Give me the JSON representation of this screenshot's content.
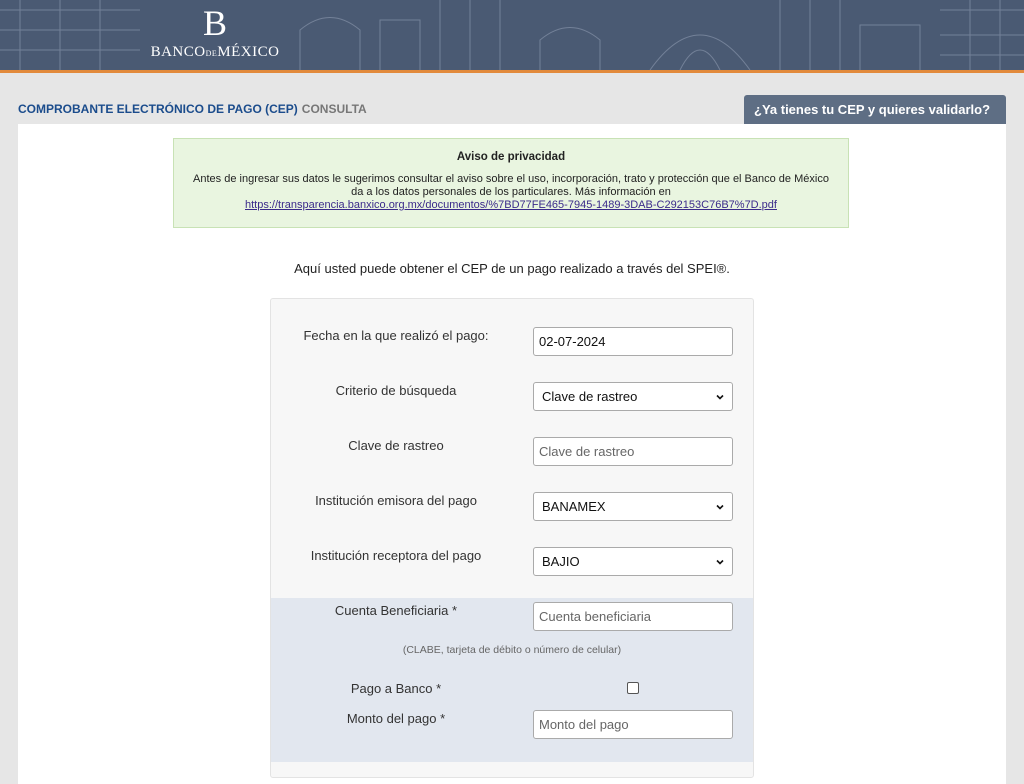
{
  "header": {
    "logo_mark": "B",
    "logo_name_left": "BANCO",
    "logo_name_mid": "DE",
    "logo_name_right": "MÉXICO"
  },
  "titlebar": {
    "title": "COMPROBANTE ELECTRÓNICO DE PAGO (CEP)",
    "subtitle": "CONSULTA",
    "validate_label": "¿Ya tienes tu CEP y quieres validarlo?"
  },
  "privacy": {
    "title": "Aviso de privacidad",
    "text_line1": "Antes de ingresar sus datos le sugerimos consultar el aviso sobre el uso, incorporación, trato y protección que el Banco de México",
    "text_line2": "da a los datos personales de los particulares. Más información en",
    "link": "https://transparencia.banxico.org.mx/documentos/%7BD77FE465-7945-1489-3DAB-C292153C76B7%7D.pdf"
  },
  "intro": "Aquí usted puede obtener el CEP de un pago realizado a través del SPEI®.",
  "form": {
    "fecha_label": "Fecha en la que realizó el pago:",
    "fecha_value": "02-07-2024",
    "criterio_label": "Criterio de búsqueda",
    "criterio_value": "Clave de rastreo",
    "clave_label": "Clave de rastreo",
    "clave_placeholder": "Clave de rastreo",
    "emisora_label": "Institución emisora del pago",
    "emisora_value": "BANAMEX",
    "receptora_label": "Institución receptora del pago",
    "receptora_value": "BAJIO",
    "cuenta_label": "Cuenta Beneficiaria *",
    "cuenta_placeholder": "Cuenta beneficiaria",
    "cuenta_hint": "(CLABE, tarjeta de débito o número de celular)",
    "pago_banco_label": "Pago a Banco *",
    "monto_label": "Monto del pago *",
    "monto_placeholder": "Monto del pago"
  },
  "colors": {
    "banner": "#4a5a73",
    "banner_accent": "#e28a3c",
    "title_blue": "#1b4c8c",
    "notice_bg": "#e9f5e0",
    "section_blue": "#e2e7ef"
  }
}
